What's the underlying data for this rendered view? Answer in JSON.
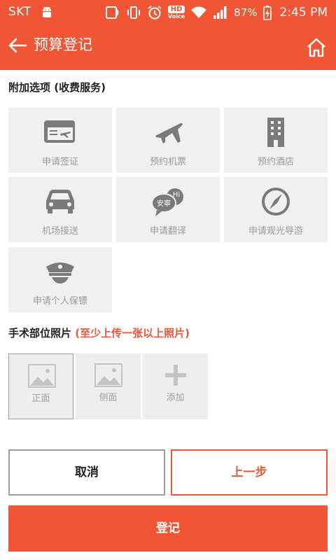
{
  "status_bar": {
    "carrier": "SKT",
    "battery": "87%",
    "time": "2:45 PM",
    "hd_label": "HD",
    "voice_label": "Voice"
  },
  "app_bar": {
    "title": "预算登记"
  },
  "addons": {
    "title": "附加选项 (收费服务)",
    "items": [
      {
        "label": "申请签证",
        "icon": "visa-card-icon"
      },
      {
        "label": "预约机票",
        "icon": "airplane-icon"
      },
      {
        "label": "预约酒店",
        "icon": "hotel-building-icon"
      },
      {
        "label": "机场接送",
        "icon": "car-icon"
      },
      {
        "label": "申请翻译",
        "icon": "translate-bubbles-icon",
        "icon_text_a": "安寧",
        "icon_text_b": "Hi"
      },
      {
        "label": "申请观光导游",
        "icon": "compass-icon"
      },
      {
        "label": "申请个人保镖",
        "icon": "guard-cap-icon"
      }
    ]
  },
  "photos": {
    "title": "手术部位照片",
    "hint": "(至少上传一张以上照片)",
    "slots": [
      {
        "label": "正面",
        "icon": "image-placeholder-icon"
      },
      {
        "label": "侧面",
        "icon": "image-placeholder-icon"
      },
      {
        "label": "添加",
        "icon": "plus-icon"
      }
    ]
  },
  "buttons": {
    "cancel": "取消",
    "previous": "上一步",
    "submit": "登记"
  },
  "colors": {
    "accent": "#f05536",
    "tile_bg": "#f0f0f0",
    "icon_gray": "#7a7a7a"
  }
}
